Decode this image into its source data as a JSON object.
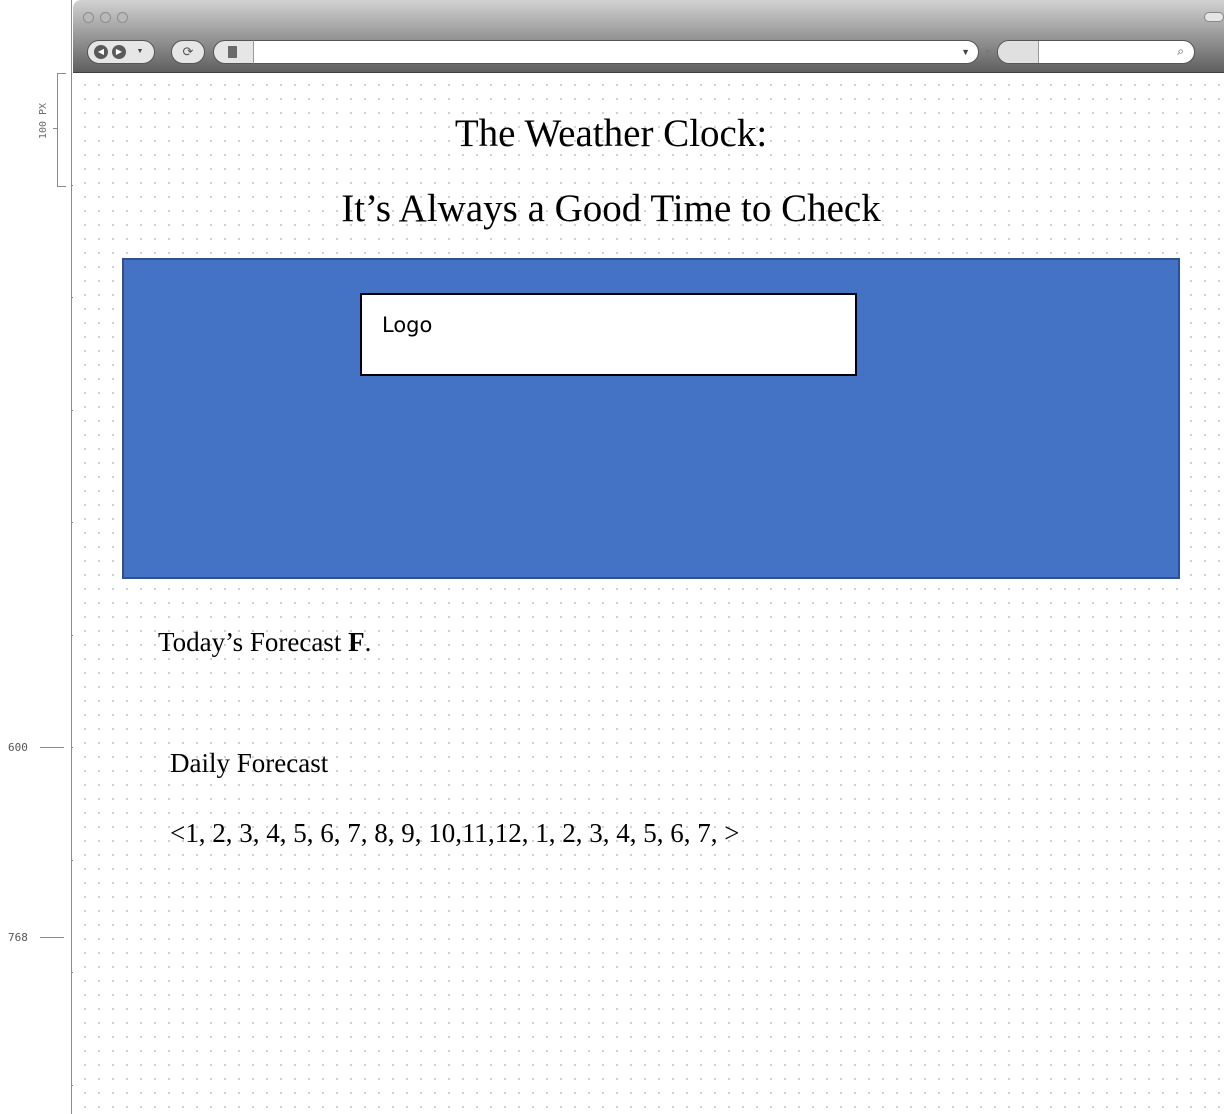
{
  "ruler": {
    "scale_label": "100 PX",
    "marks": [
      "600",
      "768"
    ]
  },
  "browser": {
    "address_value": "",
    "search_value": ""
  },
  "page": {
    "title_line_1": "The Weather Clock:",
    "title_line_2": "It’s Always a Good Time to Check",
    "banner_color": "#4472c4",
    "logo_label": "Logo",
    "today_forecast_prefix": "Today’s Forecast ",
    "today_forecast_unit": "F",
    "today_forecast_suffix": ".",
    "daily_forecast_heading": "Daily Forecast",
    "hourly_prev": "<",
    "hourly_values": "1, 2, 3, 4, 5, 6, 7, 8, 9, 10,11,12, 1, 2, 3, 4, 5, 6, 7, ",
    "hourly_next": ">"
  }
}
